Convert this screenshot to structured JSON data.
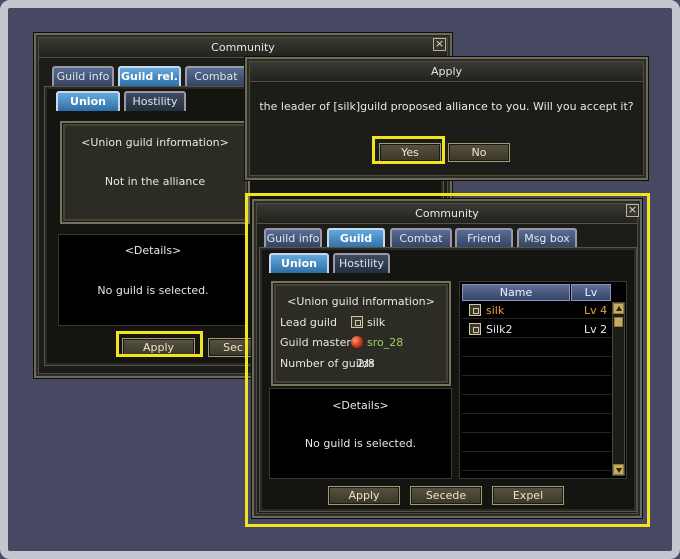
{
  "back_window": {
    "title": "Community",
    "tabs": [
      "Guild info",
      "Guild rel.",
      "Combat"
    ],
    "subtabs": [
      "Union",
      "Hostility"
    ],
    "union_info_title": "<Union guild information>",
    "alliance_status": "Not in the alliance",
    "details_title": "<Details>",
    "details_text": "No guild is selected.",
    "apply_button": "Apply",
    "secede_button": "Sec"
  },
  "apply_dialog": {
    "title": "Apply",
    "message": "the leader of [silk]guild proposed alliance to you. Will you accept it?",
    "yes_button": "Yes",
    "no_button": "No"
  },
  "front_window": {
    "title": "Community",
    "tabs": [
      "Guild info",
      "Guild rel.",
      "Combat",
      "Friend",
      "Msg box"
    ],
    "subtabs": [
      "Union",
      "Hostility"
    ],
    "union_info": {
      "title": "<Union guild information>",
      "lead_guild_label": "Lead guild",
      "lead_guild_value": "silk",
      "guild_master_label": "Guild master",
      "guild_master_value": "sro_28",
      "number_of_guilds_label": "Number of guilds",
      "number_of_guilds_value": "2/8"
    },
    "details_title": "<Details>",
    "details_text": "No guild is selected.",
    "list": {
      "headers": [
        "Name",
        "Lv"
      ],
      "rows": [
        {
          "name": "silk",
          "lv": "Lv 4"
        },
        {
          "name": "Silk2",
          "lv": "Lv 2"
        }
      ]
    },
    "buttons": [
      "Apply",
      "Secede",
      "Expel"
    ]
  },
  "colors": {
    "highlight": "#f2e41c",
    "active_tab": "#2d6ea6",
    "lead_guild_row": "#e2a04a",
    "master_name": "#9bd06a"
  },
  "icons": {
    "close": "close-icon",
    "guild": "guild-emblem-icon",
    "master": "master-orb-icon"
  }
}
